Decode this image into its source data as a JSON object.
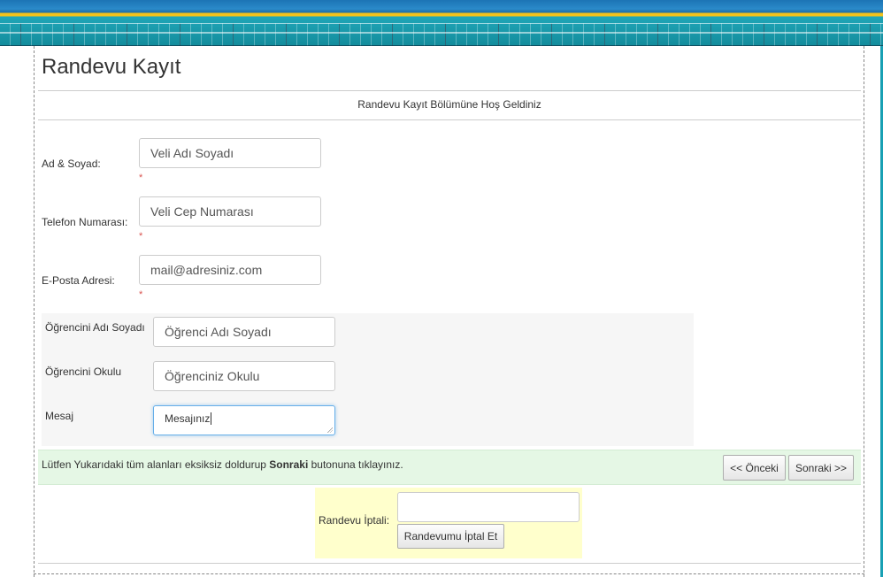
{
  "page": {
    "title": "Randevu Kayıt",
    "welcome": "Randevu Kayıt Bölümüne Hoş Geldiniz"
  },
  "form": {
    "parent_name": {
      "label": "Ad & Soyad:",
      "placeholder": "Veli Adı Soyadı",
      "required_mark": "*"
    },
    "phone": {
      "label": "Telefon Numarası:",
      "placeholder": "Veli Cep Numarası",
      "required_mark": "*"
    },
    "email": {
      "label": "E-Posta Adresi:",
      "placeholder": "mail@adresiniz.com",
      "required_mark": "*"
    },
    "student_name": {
      "label": "Öğrencini Adı Soyadı",
      "placeholder": "Öğrenci Adı Soyadı"
    },
    "student_school": {
      "label": "Öğrencini Okulu",
      "placeholder": "Öğrenciniz Okulu"
    },
    "message": {
      "label": "Mesaj",
      "value": "Mesajınız"
    }
  },
  "info_bar": {
    "text_before": "Lütfen Yukarıdaki tüm alanları eksiksiz doldurup ",
    "text_bold": "Sonraki",
    "text_after": " butonuna tıklayınız.",
    "prev_button": "<< Önceki",
    "next_button": "Sonraki >>"
  },
  "cancel": {
    "label": "Randevu İptali:",
    "input_value": "",
    "button": "Randevumu İptal Et"
  },
  "colors": {
    "banner_blue": "#1f6fa8",
    "banner_yellow": "#f3c21b",
    "banner_teal": "#138c9c",
    "required": "#d9534f",
    "info_bar_bg": "#e5f7e5",
    "cancel_box_bg": "#ffffcc",
    "focus_border": "#66afe9"
  }
}
